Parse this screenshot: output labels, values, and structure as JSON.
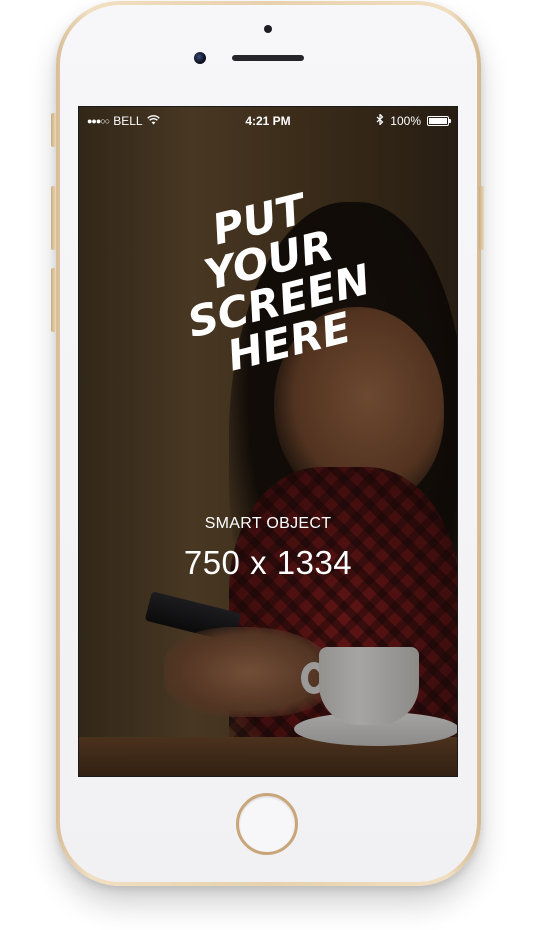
{
  "status_bar": {
    "signal": "●●●○○",
    "carrier": "BELL",
    "wifi_icon": "wifi-icon",
    "time": "4:21 PM",
    "bluetooth_icon": "bluetooth-icon",
    "battery_percent": "100%",
    "battery_level": 1.0
  },
  "screen": {
    "headline_lines": [
      "PUT",
      "YOUR",
      "SCREEN",
      "HERE"
    ],
    "smart_object_label": "SMART OBJECT",
    "dimensions": "750 x 1334"
  },
  "colors": {
    "phone_body": "#e7d1ad",
    "phone_face": "#f3f3f6",
    "text": "#ffffff"
  }
}
